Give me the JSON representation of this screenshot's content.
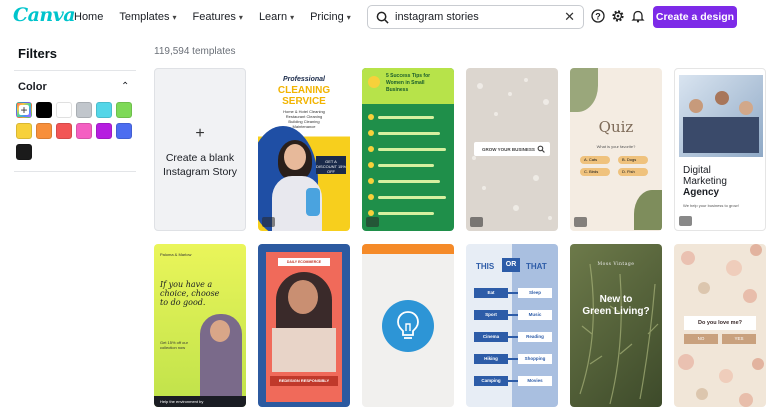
{
  "header": {
    "logo": "Canva",
    "nav": [
      {
        "label": "Home",
        "dropdown": false
      },
      {
        "label": "Templates",
        "dropdown": true
      },
      {
        "label": "Features",
        "dropdown": true
      },
      {
        "label": "Learn",
        "dropdown": true
      },
      {
        "label": "Pricing",
        "dropdown": true
      }
    ],
    "search": {
      "value": "instagram stories",
      "icon": "search-icon"
    },
    "icons": [
      "help-icon",
      "settings-icon",
      "notification-bell-icon"
    ],
    "cta_label": "Create a design",
    "accent": "#7d2ae8"
  },
  "sidebar": {
    "title": "Filters",
    "color_label": "Color",
    "swatches": [
      "custom",
      "#000000",
      "#ffffff",
      "#c1c6cc",
      "#54d6e8",
      "#7ed957",
      "#f7d13b",
      "#f78f3b",
      "#f25555",
      "#f45fc2",
      "#b61ee0",
      "#4d6df0",
      "#1b1b1b"
    ]
  },
  "results": {
    "count": "119,594 templates",
    "blank_card": {
      "line1": "Create a blank",
      "line2": "Instagram Story"
    },
    "templates": {
      "cleaning": {
        "title1": "Professional",
        "title2": "CLEANING",
        "title3": "SERVICE",
        "sub": "Home & Hotel Cleaning\nRestaurant Cleaning\nBuilding Cleaning\nMaintenance",
        "badge": "GET A DISCOUNT 15% OFF"
      },
      "women": {
        "title": "5 Success Tips for Women in Small Business"
      },
      "business": {
        "label": "GROW YOUR BUSINESS"
      },
      "quiz": {
        "title": "Quiz",
        "question": "What is your favorite?",
        "opts": [
          "A. Cats",
          "B. Dogs",
          "C. Birds",
          "D. Fish"
        ]
      },
      "marketing": {
        "title1": "Digital",
        "title2": "Marketing",
        "title3": "Agency",
        "sub": "We help your business to grow!"
      },
      "choice": {
        "brand": "Paloma & Marlow",
        "quote": "If you have a choice, choose to do good.",
        "sub": "Get 15% off our collection now",
        "footer": "Help the environment by"
      },
      "red": {
        "tag": "DAILY ECOMMERCE",
        "btn": "REDESIGN RESPONSIBLY"
      },
      "thisthat": {
        "this": "THIS",
        "or": "OR",
        "that": "THAT",
        "left": [
          "Eat",
          "Sport",
          "Cinema",
          "Hiking",
          "Camping"
        ],
        "right": [
          "Sleep",
          "Music",
          "Reading",
          "Shopping",
          "Movies"
        ]
      },
      "green": {
        "brand": "Moss Vintage",
        "title1": "New to",
        "title2": "Green Living?"
      },
      "love": {
        "title": "Do you love me?",
        "no": "NO",
        "yes": "YES"
      }
    }
  }
}
